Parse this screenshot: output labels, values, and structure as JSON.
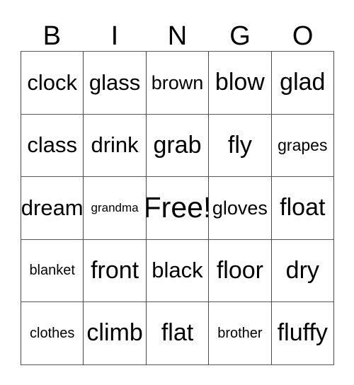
{
  "card": {
    "title": "BINGO",
    "headers": [
      "B",
      "I",
      "N",
      "G",
      "O"
    ],
    "rows": [
      [
        {
          "text": "clock",
          "size": "large"
        },
        {
          "text": "glass",
          "size": "large"
        },
        {
          "text": "brown",
          "size": "medium"
        },
        {
          "text": "blow",
          "size": "xlarge"
        },
        {
          "text": "glad",
          "size": "xlarge"
        }
      ],
      [
        {
          "text": "class",
          "size": "large"
        },
        {
          "text": "drink",
          "size": "large"
        },
        {
          "text": "grab",
          "size": "xlarge"
        },
        {
          "text": "fly",
          "size": "xlarge"
        },
        {
          "text": "grapes",
          "size": "small"
        }
      ],
      [
        {
          "text": "dream",
          "size": "large"
        },
        {
          "text": "grandma",
          "size": "tiny"
        },
        {
          "text": "Free!",
          "size": "free"
        },
        {
          "text": "gloves",
          "size": "medium"
        },
        {
          "text": "float",
          "size": "xlarge"
        }
      ],
      [
        {
          "text": "blanket",
          "size": "xsmall"
        },
        {
          "text": "front",
          "size": "xlarge"
        },
        {
          "text": "black",
          "size": "large"
        },
        {
          "text": "floor",
          "size": "xlarge"
        },
        {
          "text": "dry",
          "size": "xlarge"
        }
      ],
      [
        {
          "text": "clothes",
          "size": "xsmall"
        },
        {
          "text": "climb",
          "size": "xlarge"
        },
        {
          "text": "flat",
          "size": "xlarge"
        },
        {
          "text": "brother",
          "size": "xsmall"
        },
        {
          "text": "fluffy",
          "size": "xlarge"
        }
      ]
    ],
    "free_space": {
      "row": 2,
      "col": 2,
      "label": "Free!"
    },
    "colors": {
      "text": "#000000",
      "background": "#ffffff",
      "grid_line": "#4a4a4c"
    }
  }
}
